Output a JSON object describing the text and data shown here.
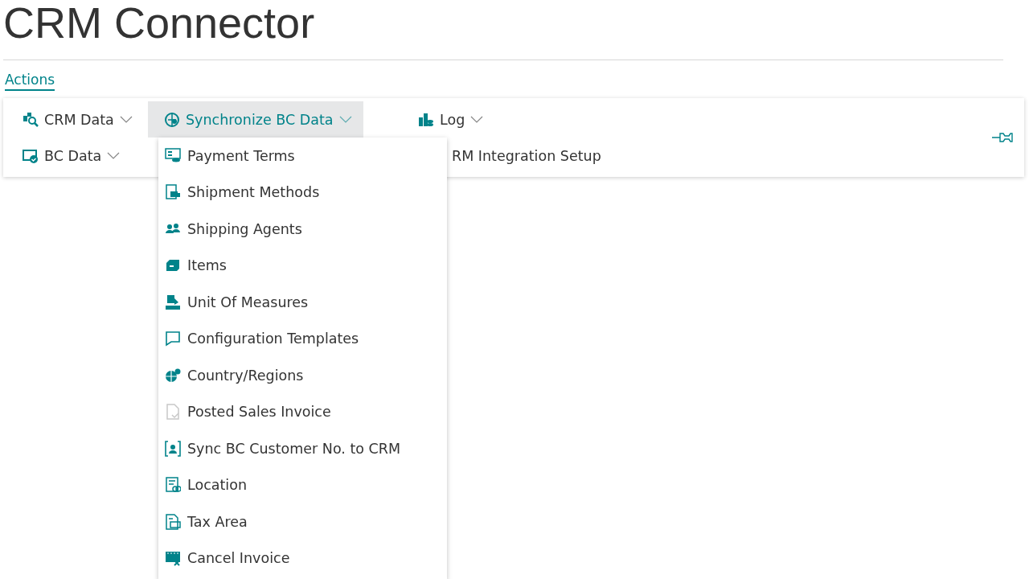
{
  "page_title": "CRM Connector",
  "action_tabs": [
    {
      "label": "Actions",
      "selected": true
    }
  ],
  "action_rows": [
    [
      {
        "kind": "menu",
        "label": "CRM Data",
        "expanded": false
      },
      {
        "kind": "menu",
        "label": "Synchronize BC Data",
        "expanded": true
      },
      {
        "kind": "menu",
        "label": "Log",
        "expanded": false
      }
    ],
    [
      {
        "kind": "menu",
        "label": "BC Data",
        "expanded": false
      },
      null,
      {
        "kind": "action",
        "label": "RM Integration Setup"
      }
    ]
  ],
  "menu": {
    "items": [
      {
        "label": "Payment Terms"
      },
      {
        "label": "Shipment Methods"
      },
      {
        "label": "Shipping Agents"
      },
      {
        "label": "Items"
      },
      {
        "label": "Unit Of Measures"
      },
      {
        "label": "Configuration Templates"
      },
      {
        "label": "Country/Regions"
      },
      {
        "label": "Posted Sales Invoice"
      },
      {
        "label": "Sync BC Customer No. to CRM"
      },
      {
        "label": "Location"
      },
      {
        "label": "Tax Area"
      },
      {
        "label": "Cancel Invoice"
      }
    ]
  }
}
